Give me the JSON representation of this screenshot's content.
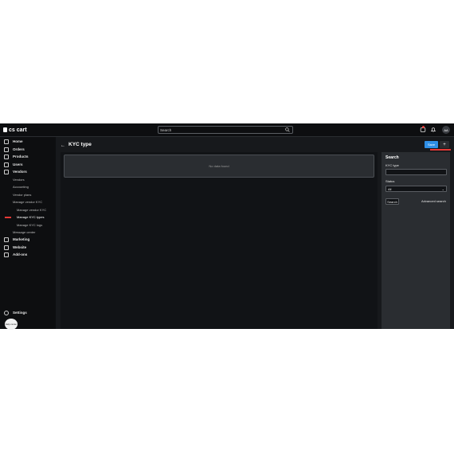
{
  "topbar": {
    "logo_text": "cs cart",
    "search_placeholder": "Search",
    "avatar_initials": "AA"
  },
  "sidebar": {
    "items": [
      {
        "label": "Home",
        "icon": "home-icon"
      },
      {
        "label": "Orders",
        "icon": "cart-icon"
      },
      {
        "label": "Products",
        "icon": "tag-icon"
      },
      {
        "label": "Users",
        "icon": "user-icon"
      },
      {
        "label": "Vendors",
        "icon": "vendors-icon"
      }
    ],
    "vendor_sub": [
      "Vendors",
      "Accounting",
      "Vendor plans",
      "Manage vendor KYC"
    ],
    "kyc_sub": [
      "Manage vendor KYC",
      "Manage KYC types",
      "Manage KYC logs"
    ],
    "message_center": "Message center",
    "items2": [
      {
        "label": "Marketing",
        "icon": "megaphone-icon"
      },
      {
        "label": "Website",
        "icon": "monitor-icon"
      },
      {
        "label": "Add-ons",
        "icon": "puzzle-icon"
      }
    ],
    "settings": "Settings",
    "help_label": "Help center"
  },
  "header": {
    "title": "KYC type",
    "save_label": "Save",
    "add_label": "+"
  },
  "main": {
    "empty_text": "No data found"
  },
  "search_panel": {
    "title": "Search",
    "kyc_type_label": "KYC type",
    "kyc_type_value": "",
    "status_label": "Status",
    "status_value": "All",
    "search_button": "Search",
    "advanced_link": "Advanced search"
  }
}
